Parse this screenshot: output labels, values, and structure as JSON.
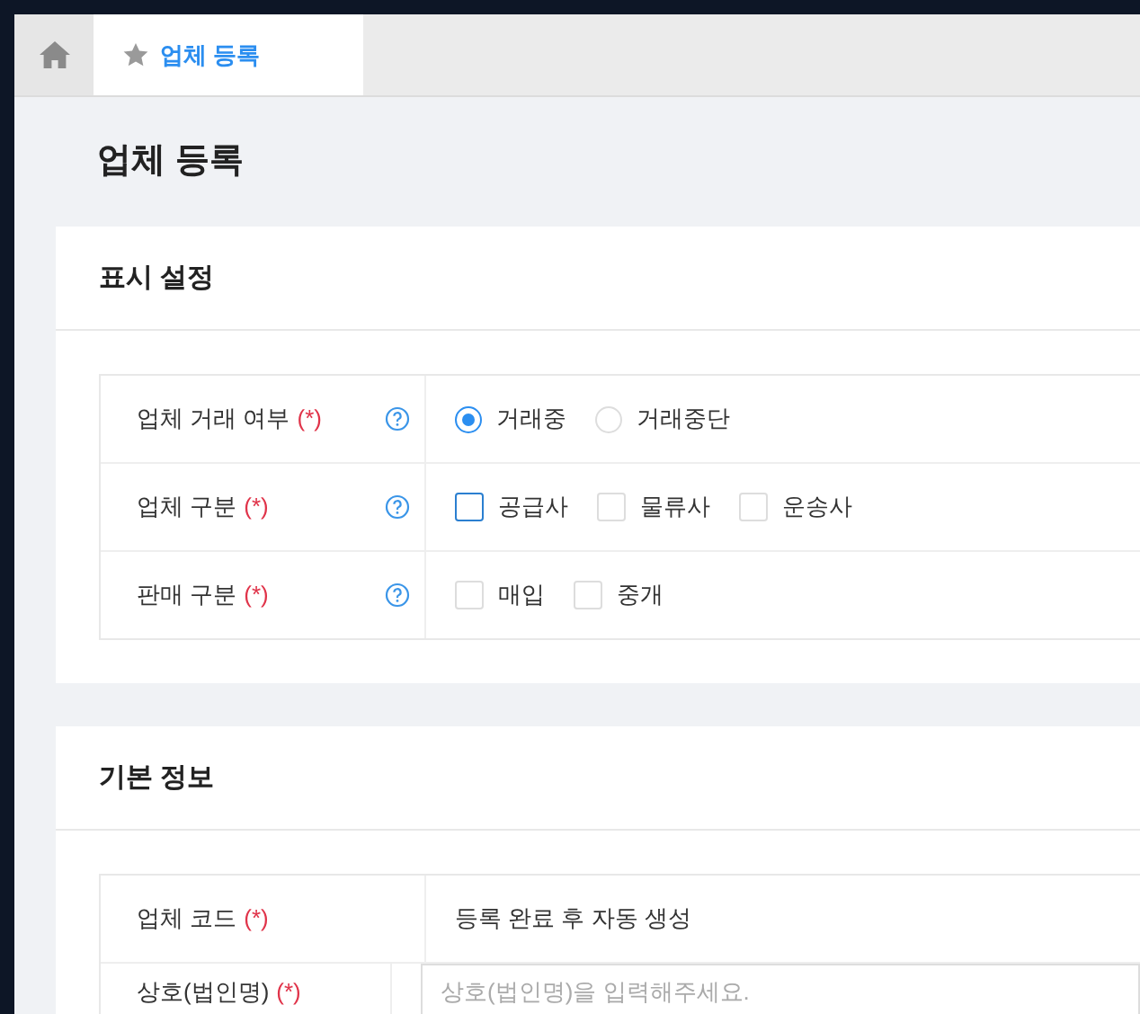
{
  "tabs": [
    {
      "kind": "home",
      "selected": false
    },
    {
      "kind": "page",
      "label": "업체 등록",
      "selected": true
    }
  ],
  "page_title": "업체 등록",
  "sections": [
    {
      "title": "표시 설정",
      "rows": [
        {
          "label": "업체 거래 여부",
          "required_mark": "(*)",
          "help": true,
          "kind": "radio",
          "options": [
            {
              "label": "거래중",
              "selected": true
            },
            {
              "label": "거래중단",
              "selected": false
            }
          ]
        },
        {
          "label": "업체 구분",
          "required_mark": "(*)",
          "help": true,
          "kind": "checkbox",
          "options": [
            {
              "label": "공급사",
              "checked": false,
              "focused": true
            },
            {
              "label": "물류사",
              "checked": false,
              "focused": false
            },
            {
              "label": "운송사",
              "checked": false,
              "focused": false
            }
          ]
        },
        {
          "label": "판매 구분",
          "required_mark": "(*)",
          "help": true,
          "kind": "checkbox",
          "options": [
            {
              "label": "매입",
              "checked": false,
              "focused": false
            },
            {
              "label": "중개",
              "checked": false,
              "focused": false
            }
          ]
        }
      ]
    },
    {
      "title": "기본 정보",
      "rows": [
        {
          "label": "업체 코드",
          "required_mark": "(*)",
          "help": false,
          "kind": "text",
          "value": "등록 완료 후 자동 생성"
        },
        {
          "label": "상호(법인명)",
          "required_mark": "(*)",
          "help": false,
          "kind": "input",
          "placeholder": "상호(법인명)을 입력해주세요."
        }
      ]
    }
  ]
}
